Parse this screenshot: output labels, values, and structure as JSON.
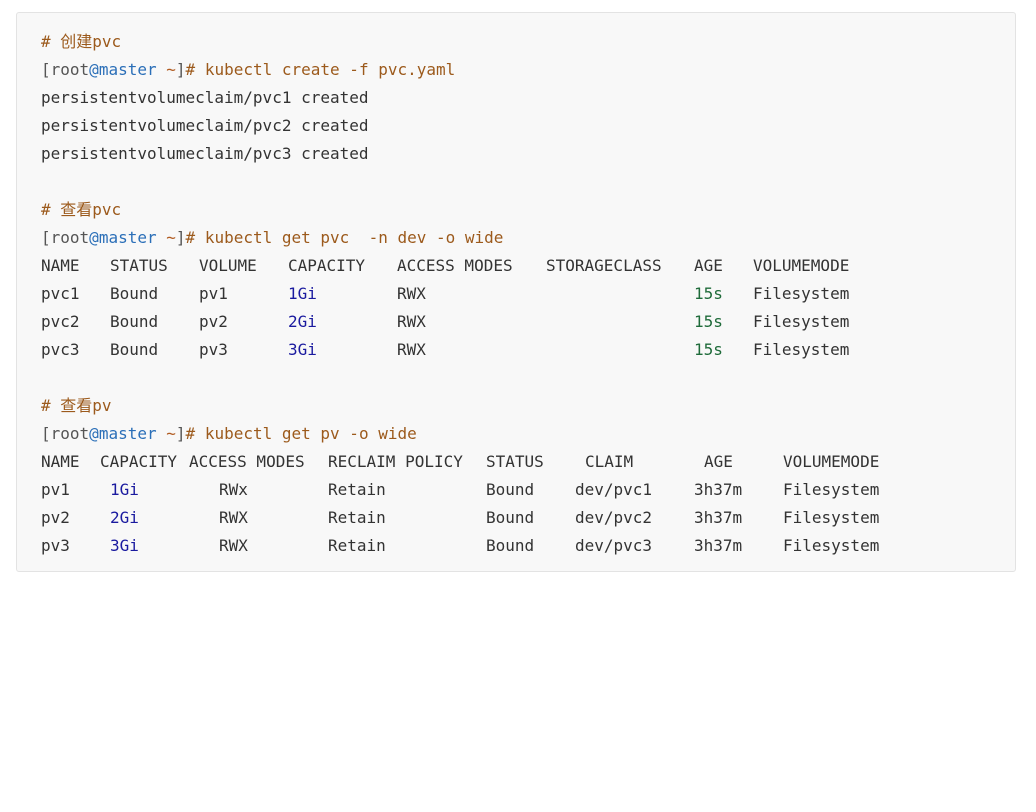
{
  "section_create": {
    "comment": "# 创建pvc",
    "prompt": {
      "user": "root",
      "at": "@",
      "host": "master",
      "path": "~",
      "hash": "#"
    },
    "command": "kubectl create -f pvc.yaml",
    "outputs": [
      "persistentvolumeclaim/pvc1 created",
      "persistentvolumeclaim/pvc2 created",
      "persistentvolumeclaim/pvc3 created"
    ]
  },
  "section_get_pvc": {
    "comment": "# 查看pvc",
    "prompt": {
      "user": "root",
      "at": "@",
      "host": "master",
      "path": "~",
      "hash": "#"
    },
    "command": "kubectl get pvc  -n dev -o wide",
    "headers": [
      "NAME",
      "STATUS",
      "VOLUME",
      "CAPACITY",
      "ACCESS MODES",
      "STORAGECLASS",
      "AGE",
      "VOLUMEMODE"
    ],
    "rows": [
      {
        "name": "pvc1",
        "status": "Bound",
        "volume": "pv1",
        "cap_num": "1",
        "cap_unit": "Gi",
        "access": "RWX",
        "storageclass": "",
        "age": "15s",
        "mode": "Filesystem"
      },
      {
        "name": "pvc2",
        "status": "Bound",
        "volume": "pv2",
        "cap_num": "2",
        "cap_unit": "Gi",
        "access": "RWX",
        "storageclass": "",
        "age": "15s",
        "mode": "Filesystem"
      },
      {
        "name": "pvc3",
        "status": "Bound",
        "volume": "pv3",
        "cap_num": "3",
        "cap_unit": "Gi",
        "access": "RWX",
        "storageclass": "",
        "age": "15s",
        "mode": "Filesystem"
      }
    ]
  },
  "section_get_pv": {
    "comment": "# 查看pv",
    "prompt": {
      "user": "root",
      "at": "@",
      "host": "master",
      "path": "~",
      "hash": "#"
    },
    "command": "kubectl get pv -o wide",
    "headers": [
      "NAME",
      "CAPACITY",
      "ACCESS MODES",
      "RECLAIM POLICY",
      "STATUS",
      "CLAIM",
      "AGE",
      "VOLUMEMODE"
    ],
    "rows": [
      {
        "name": "pv1",
        "cap_num": "1",
        "cap_unit": "Gi",
        "access": "RWx",
        "policy": "Retain",
        "status": "Bound",
        "claim": "dev/pvc1",
        "age": "3h37m",
        "mode": "Filesystem"
      },
      {
        "name": "pv2",
        "cap_num": "2",
        "cap_unit": "Gi",
        "access": "RWX",
        "policy": "Retain",
        "status": "Bound",
        "claim": "dev/pvc2",
        "age": "3h37m",
        "mode": "Filesystem"
      },
      {
        "name": "pv3",
        "cap_num": "3",
        "cap_unit": "Gi",
        "access": "RWX",
        "policy": "Retain",
        "status": "Bound",
        "claim": "dev/pvc3",
        "age": "3h37m",
        "mode": "Filesystem"
      }
    ]
  }
}
